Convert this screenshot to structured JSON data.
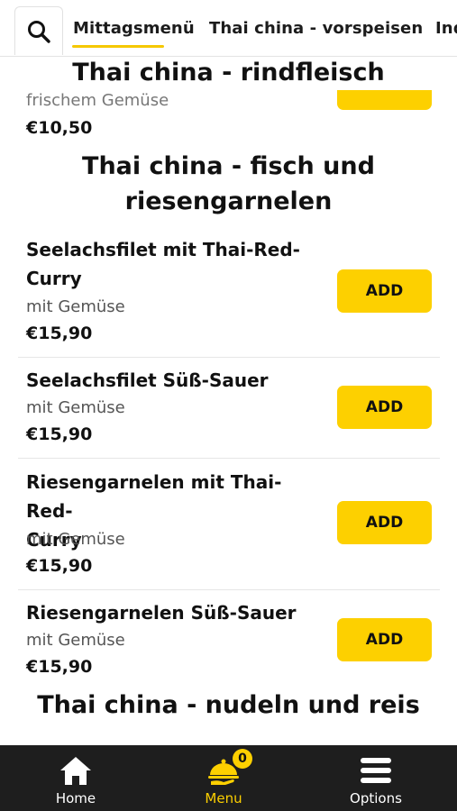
{
  "header": {
    "tabs": [
      {
        "label": "Mittagsmenü",
        "active": true
      },
      {
        "label": "Thai china - vorspeisen",
        "active": false
      },
      {
        "label": "Ind",
        "active": false
      }
    ]
  },
  "sticky_section_title": "Thai china - rindfleisch",
  "partial_item": {
    "desc": "frischem Gemüse",
    "price": "€10,50"
  },
  "section": {
    "title_line1": "Thai china - fisch und",
    "title_line2": "riesengarnelen"
  },
  "items": [
    {
      "name_line1": "Seelachsfilet mit Thai-Red-",
      "name_line2": "Curry",
      "desc": "mit Gemüse",
      "price": "€15,90",
      "button": "ADD"
    },
    {
      "name_line1": "Seelachsfilet Süß-Sauer",
      "desc": "mit Gemüse",
      "price": "€15,90",
      "button": "ADD"
    },
    {
      "name_line1": "Riesengarnelen mit Thai-Red-",
      "name_line2": "Curry",
      "desc": "mit Gemüse",
      "price": "€15,90",
      "button": "ADD"
    },
    {
      "name_line1": "Riesengarnelen Süß-Sauer",
      "desc": "mit Gemüse",
      "price": "€15,90",
      "button": "ADD"
    }
  ],
  "next_section_title": "Thai china - nudeln und reis",
  "bottom_nav": {
    "home": "Home",
    "menu": "Menu",
    "options": "Options",
    "cart_count": "0"
  },
  "colors": {
    "accent": "#fdd000",
    "nav_background": "#1e1e1e"
  }
}
